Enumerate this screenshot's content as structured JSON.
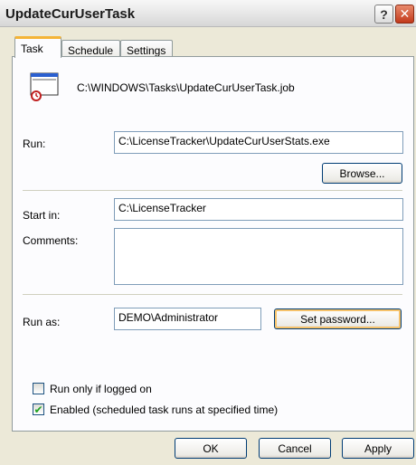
{
  "window": {
    "title": "UpdateCurUserTask"
  },
  "title_buttons": {
    "help": "?",
    "close": "✕"
  },
  "tabs": [
    {
      "label": "Task",
      "active": true
    },
    {
      "label": "Schedule",
      "active": false
    },
    {
      "label": "Settings",
      "active": false
    }
  ],
  "task": {
    "file_path": "C:\\WINDOWS\\Tasks\\UpdateCurUserTask.job",
    "run_label": "Run:",
    "run_value": "C:\\LicenseTracker\\UpdateCurUserStats.exe",
    "browse_label": "Browse...",
    "start_in_label": "Start in:",
    "start_in_value": "C:\\LicenseTracker",
    "comments_label": "Comments:",
    "comments_value": "",
    "run_as_label": "Run as:",
    "run_as_value": "DEMO\\Administrator",
    "set_password_label": "Set password...",
    "run_only_logged_on_label": "Run only if logged on",
    "run_only_logged_on_checked": false,
    "enabled_label": "Enabled (scheduled task runs at specified time)",
    "enabled_checked": true
  },
  "footer": {
    "ok": "OK",
    "cancel": "Cancel",
    "apply": "Apply"
  },
  "icons": {
    "task_icon": "scheduled-task-icon",
    "check_mark": "✔"
  },
  "colors": {
    "accent_tab": "#f4b437",
    "check_green": "#21a121",
    "close_red": "#c2391b"
  }
}
